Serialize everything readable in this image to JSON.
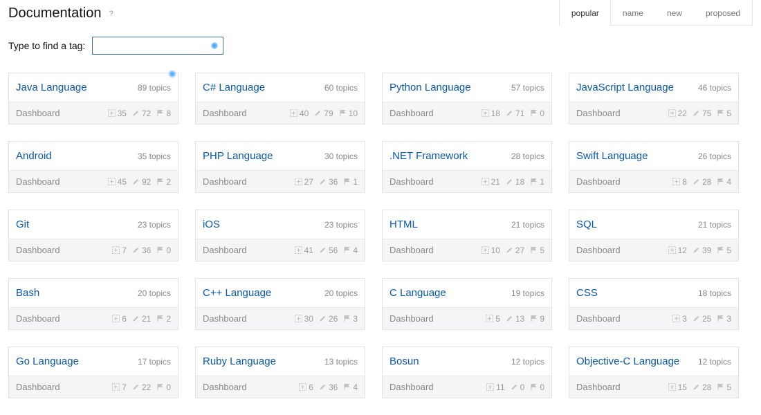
{
  "header": {
    "title": "Documentation",
    "help": "?"
  },
  "sortTabs": [
    {
      "label": "popular",
      "active": true
    },
    {
      "label": "name"
    },
    {
      "label": "new"
    },
    {
      "label": "proposed"
    }
  ],
  "search": {
    "label": "Type to find a tag:",
    "value": ""
  },
  "topicsWord": "topics",
  "dashboardLabel": "Dashboard",
  "cards": [
    {
      "name": "Java Language",
      "topics": 89,
      "new": 35,
      "edit": 72,
      "flag": 8,
      "dot": true
    },
    {
      "name": "C# Language",
      "topics": 60,
      "new": 40,
      "edit": 79,
      "flag": 10
    },
    {
      "name": "Python Language",
      "topics": 57,
      "new": 18,
      "edit": 71,
      "flag": 0
    },
    {
      "name": "JavaScript Language",
      "topics": 46,
      "new": 22,
      "edit": 75,
      "flag": 5
    },
    {
      "name": "Android",
      "topics": 35,
      "new": 45,
      "edit": 92,
      "flag": 2
    },
    {
      "name": "PHP Language",
      "topics": 30,
      "new": 27,
      "edit": 36,
      "flag": 1
    },
    {
      "name": ".NET Framework",
      "topics": 28,
      "new": 21,
      "edit": 18,
      "flag": 1
    },
    {
      "name": "Swift Language",
      "topics": 26,
      "new": 8,
      "edit": 28,
      "flag": 4
    },
    {
      "name": "Git",
      "topics": 23,
      "new": 7,
      "edit": 36,
      "flag": 0
    },
    {
      "name": "iOS",
      "topics": 23,
      "new": 41,
      "edit": 56,
      "flag": 4
    },
    {
      "name": "HTML",
      "topics": 21,
      "new": 10,
      "edit": 27,
      "flag": 5
    },
    {
      "name": "SQL",
      "topics": 21,
      "new": 12,
      "edit": 39,
      "flag": 5
    },
    {
      "name": "Bash",
      "topics": 20,
      "new": 6,
      "edit": 21,
      "flag": 2
    },
    {
      "name": "C++ Language",
      "topics": 20,
      "new": 30,
      "edit": 26,
      "flag": 3
    },
    {
      "name": "C Language",
      "topics": 19,
      "new": 5,
      "edit": 13,
      "flag": 9
    },
    {
      "name": "CSS",
      "topics": 18,
      "new": 3,
      "edit": 25,
      "flag": 3
    },
    {
      "name": "Go Language",
      "topics": 17,
      "new": 7,
      "edit": 22,
      "flag": 0
    },
    {
      "name": "Ruby Language",
      "topics": 13,
      "new": 6,
      "edit": 36,
      "flag": 4
    },
    {
      "name": "Bosun",
      "topics": 12,
      "new": 11,
      "edit": 0,
      "flag": 0
    },
    {
      "name": "Objective-C Language",
      "topics": 12,
      "new": 15,
      "edit": 28,
      "flag": 5
    }
  ]
}
